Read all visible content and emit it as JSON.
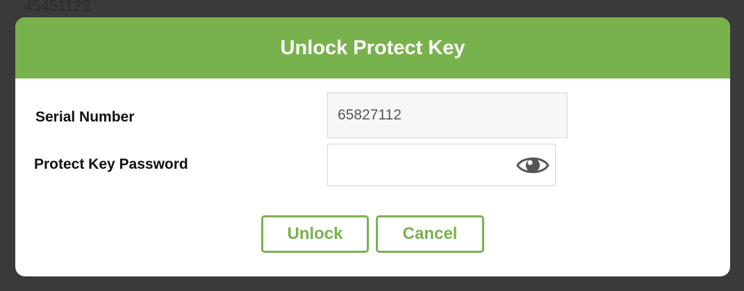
{
  "backdrop": {
    "partial_text": "45451122"
  },
  "dialog": {
    "title": "Unlock Protect Key",
    "header_color": "#78b24c",
    "fields": {
      "serial_label": "Serial Number",
      "serial_value": "65827112",
      "password_label": "Protect Key Password",
      "password_value": ""
    },
    "icons": {
      "password_toggle": "eye-icon"
    },
    "buttons": {
      "unlock_label": "Unlock",
      "cancel_label": "Cancel",
      "accent_color": "#78b24c"
    }
  }
}
